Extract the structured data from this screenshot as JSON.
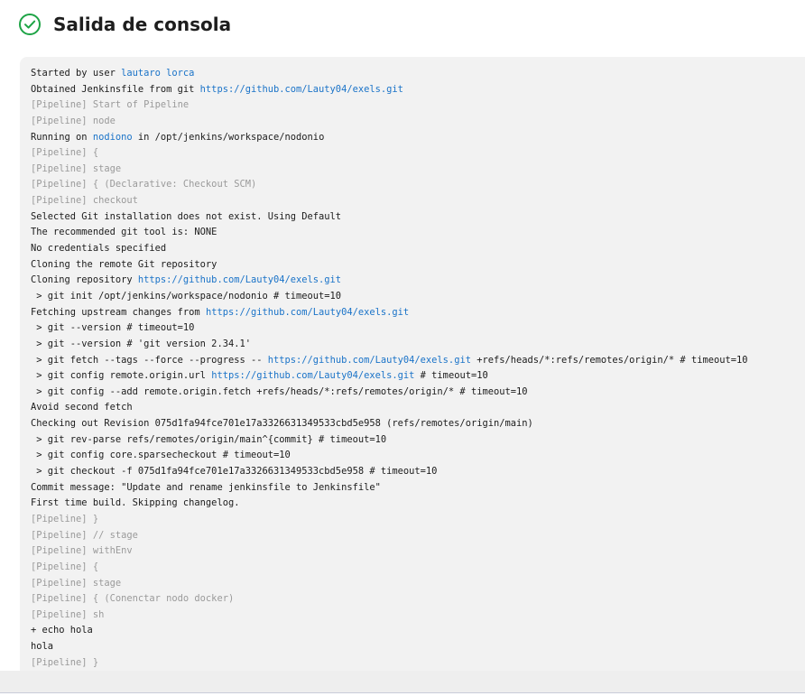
{
  "header": {
    "title": "Salida de consola",
    "status_icon": "check-circle-icon",
    "status_color": "#1ea446"
  },
  "colors": {
    "link": "#1a73c8",
    "pipeline": "#9a9a9a",
    "console_bg": "#f2f2f2"
  },
  "console": {
    "lines": [
      {
        "segments": [
          {
            "t": "Started by user "
          },
          {
            "t": "lautaro lorca",
            "link": true
          }
        ]
      },
      {
        "segments": [
          {
            "t": "Obtained Jenkinsfile from git "
          },
          {
            "t": "https://github.com/Lauty04/exels.git",
            "link": true
          }
        ]
      },
      {
        "pipeline": true,
        "segments": [
          {
            "t": "[Pipeline] Start of Pipeline"
          }
        ]
      },
      {
        "pipeline": true,
        "segments": [
          {
            "t": "[Pipeline] node"
          }
        ]
      },
      {
        "segments": [
          {
            "t": "Running on "
          },
          {
            "t": "nodiono",
            "link": true
          },
          {
            "t": " in /opt/jenkins/workspace/nodonio"
          }
        ]
      },
      {
        "pipeline": true,
        "segments": [
          {
            "t": "[Pipeline] {"
          }
        ]
      },
      {
        "pipeline": true,
        "segments": [
          {
            "t": "[Pipeline] stage"
          }
        ]
      },
      {
        "pipeline": true,
        "segments": [
          {
            "t": "[Pipeline] { (Declarative: Checkout SCM)"
          }
        ]
      },
      {
        "pipeline": true,
        "segments": [
          {
            "t": "[Pipeline] checkout"
          }
        ]
      },
      {
        "segments": [
          {
            "t": "Selected Git installation does not exist. Using Default"
          }
        ]
      },
      {
        "segments": [
          {
            "t": "The recommended git tool is: NONE"
          }
        ]
      },
      {
        "segments": [
          {
            "t": "No credentials specified"
          }
        ]
      },
      {
        "segments": [
          {
            "t": "Cloning the remote Git repository"
          }
        ]
      },
      {
        "segments": [
          {
            "t": "Cloning repository "
          },
          {
            "t": "https://github.com/Lauty04/exels.git",
            "link": true
          }
        ]
      },
      {
        "segments": [
          {
            "t": " > git init /opt/jenkins/workspace/nodonio # timeout=10"
          }
        ]
      },
      {
        "segments": [
          {
            "t": "Fetching upstream changes from "
          },
          {
            "t": "https://github.com/Lauty04/exels.git",
            "link": true
          }
        ]
      },
      {
        "segments": [
          {
            "t": " > git --version # timeout=10"
          }
        ]
      },
      {
        "segments": [
          {
            "t": " > git --version # 'git version 2.34.1'"
          }
        ]
      },
      {
        "segments": [
          {
            "t": " > git fetch --tags --force --progress -- "
          },
          {
            "t": "https://github.com/Lauty04/exels.git",
            "link": true
          },
          {
            "t": " +refs/heads/*:refs/remotes/origin/* # timeout=10"
          }
        ]
      },
      {
        "segments": [
          {
            "t": " > git config remote.origin.url "
          },
          {
            "t": "https://github.com/Lauty04/exels.git",
            "link": true
          },
          {
            "t": " # timeout=10"
          }
        ]
      },
      {
        "segments": [
          {
            "t": " > git config --add remote.origin.fetch +refs/heads/*:refs/remotes/origin/* # timeout=10"
          }
        ]
      },
      {
        "segments": [
          {
            "t": "Avoid second fetch"
          }
        ]
      },
      {
        "segments": [
          {
            "t": "Checking out Revision 075d1fa94fce701e17a3326631349533cbd5e958 (refs/remotes/origin/main)"
          }
        ]
      },
      {
        "segments": [
          {
            "t": " > git rev-parse refs/remotes/origin/main^{commit} # timeout=10"
          }
        ]
      },
      {
        "segments": [
          {
            "t": " > git config core.sparsecheckout # timeout=10"
          }
        ]
      },
      {
        "segments": [
          {
            "t": " > git checkout -f 075d1fa94fce701e17a3326631349533cbd5e958 # timeout=10"
          }
        ]
      },
      {
        "segments": [
          {
            "t": "Commit message: \"Update and rename jenkinsfile to Jenkinsfile\""
          }
        ]
      },
      {
        "segments": [
          {
            "t": "First time build. Skipping changelog."
          }
        ]
      },
      {
        "pipeline": true,
        "segments": [
          {
            "t": "[Pipeline] }"
          }
        ]
      },
      {
        "pipeline": true,
        "segments": [
          {
            "t": "[Pipeline] // stage"
          }
        ]
      },
      {
        "pipeline": true,
        "segments": [
          {
            "t": "[Pipeline] withEnv"
          }
        ]
      },
      {
        "pipeline": true,
        "segments": [
          {
            "t": "[Pipeline] {"
          }
        ]
      },
      {
        "pipeline": true,
        "segments": [
          {
            "t": "[Pipeline] stage"
          }
        ]
      },
      {
        "pipeline": true,
        "segments": [
          {
            "t": "[Pipeline] { (Conenctar nodo docker)"
          }
        ]
      },
      {
        "pipeline": true,
        "segments": [
          {
            "t": "[Pipeline] sh"
          }
        ]
      },
      {
        "segments": [
          {
            "t": "+ echo hola"
          }
        ]
      },
      {
        "segments": [
          {
            "t": "hola"
          }
        ]
      },
      {
        "pipeline": true,
        "segments": [
          {
            "t": "[Pipeline] }"
          }
        ]
      }
    ]
  }
}
